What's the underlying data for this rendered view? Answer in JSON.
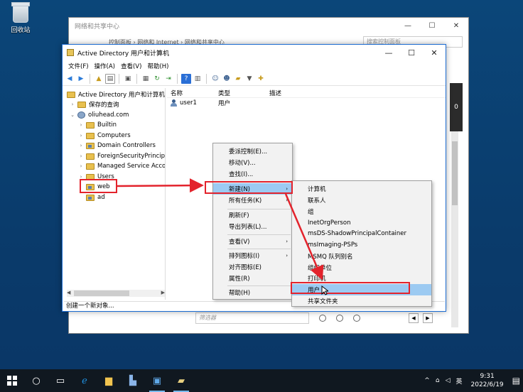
{
  "desktop": {
    "recycle_bin_label": "回收站"
  },
  "bg_window": {
    "title": "网络和共享中心",
    "address": "控制面板  ›  网络和 Internet  ›  网络和共享中心",
    "search_placeholder": "搜索控制面板",
    "side_letter": "0",
    "filter_placeholder": "筛选器"
  },
  "ad_window": {
    "title": "Active Directory 用户和计算机",
    "controls": {
      "minimize": "—",
      "maximize": "☐",
      "close": "✕"
    },
    "menu": [
      "文件(F)",
      "操作(A)",
      "查看(V)",
      "帮助(H)"
    ],
    "tree": {
      "root": "Active Directory 用户和计算机",
      "saved_queries": "保存的查询",
      "domain": "oliuhead.com",
      "children": [
        "Builtin",
        "Computers",
        "Domain Controllers",
        "ForeignSecurityPrincipals",
        "Managed Service Accounts",
        "Users",
        "web",
        "ad"
      ]
    },
    "list": {
      "columns": [
        "名称",
        "类型",
        "描述"
      ],
      "rows": [
        {
          "name": "user1",
          "type": "用户",
          "desc": ""
        }
      ]
    },
    "status": "创建一个新对象..."
  },
  "context_menu": {
    "items": [
      "委派控制(E)...",
      "移动(V)...",
      "查找(I)...",
      "新建(N)",
      "所有任务(K)",
      "刷新(F)",
      "导出列表(L)...",
      "查看(V)",
      "排列图标(I)",
      "对齐图标(E)",
      "属性(R)",
      "帮助(H)"
    ],
    "submenu_arrow": "›"
  },
  "submenu": {
    "items": [
      "计算机",
      "联系人",
      "组",
      "InetOrgPerson",
      "msDS-ShadowPrincipalContainer",
      "msImaging-PSPs",
      "MSMQ 队列别名",
      "组织单位",
      "打印机",
      "用户",
      "共享文件夹"
    ]
  },
  "taskbar": {
    "time": "9:31",
    "date": "2022/6/19",
    "ime": "英",
    "tray_up": "^"
  }
}
